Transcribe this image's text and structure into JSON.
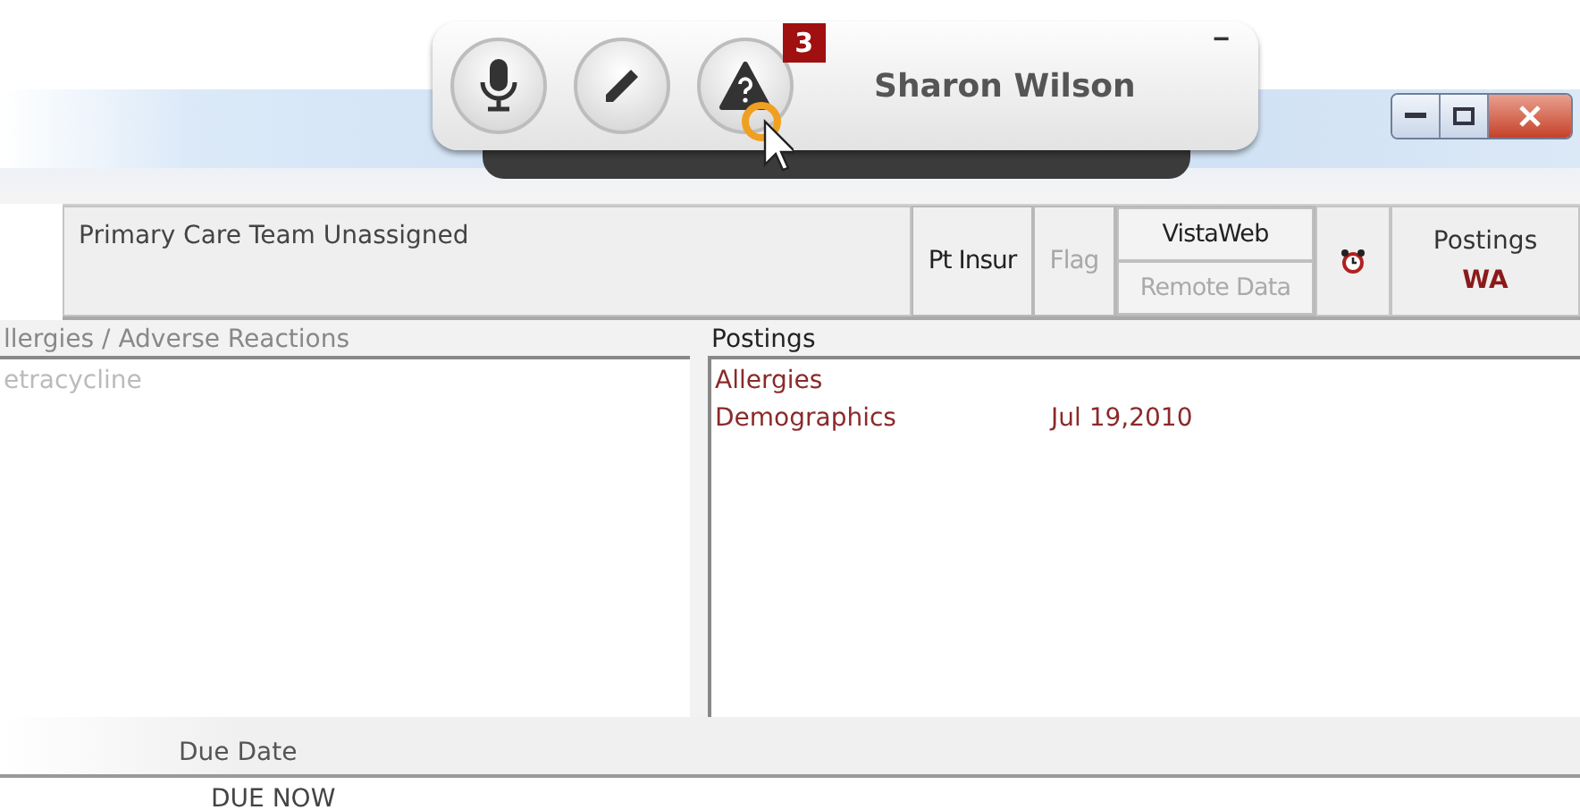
{
  "toolbar": {
    "buttons": [
      {
        "kind": "mic"
      },
      {
        "kind": "pencil"
      },
      {
        "kind": "alert",
        "badge": "3"
      }
    ],
    "user": "Sharon Wilson",
    "minimize": "−"
  },
  "header": {
    "team": "Primary Care Team Unassigned",
    "buttons": [
      {
        "label": "Pt Insur",
        "disabled": false
      },
      {
        "label": "Flag",
        "disabled": true
      }
    ],
    "vistaweb": {
      "label": "VistaWeb",
      "remote": "Remote Data",
      "remote_disabled": true
    },
    "postings": {
      "label": "Postings",
      "code": "WA"
    }
  },
  "allergies": {
    "title": "llergies / Adverse Reactions",
    "items": [
      "etracycline"
    ]
  },
  "postings": {
    "title": "Postings",
    "items": [
      {
        "name": "Allergies"
      },
      {
        "name": "Demographics",
        "date": "Jul 19,2010"
      }
    ]
  },
  "reminders": {
    "column": "Due Date",
    "rows": [
      "DUE NOW"
    ]
  }
}
